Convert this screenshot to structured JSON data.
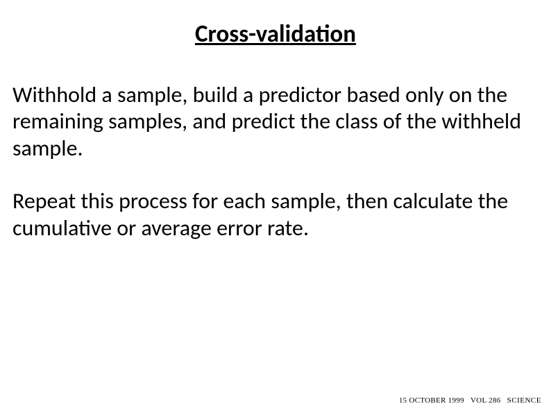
{
  "title": "Cross-validation",
  "paragraphs": [
    "Withhold a sample, build a predictor based only on the remaining samples, and predict the class of the withheld sample.",
    "Repeat this process for each sample, then calculate the cumulative or average error rate."
  ],
  "footer": {
    "date": "15 OCTOBER 1999",
    "vol": "VOL 286",
    "brand": "SCIENCE"
  }
}
